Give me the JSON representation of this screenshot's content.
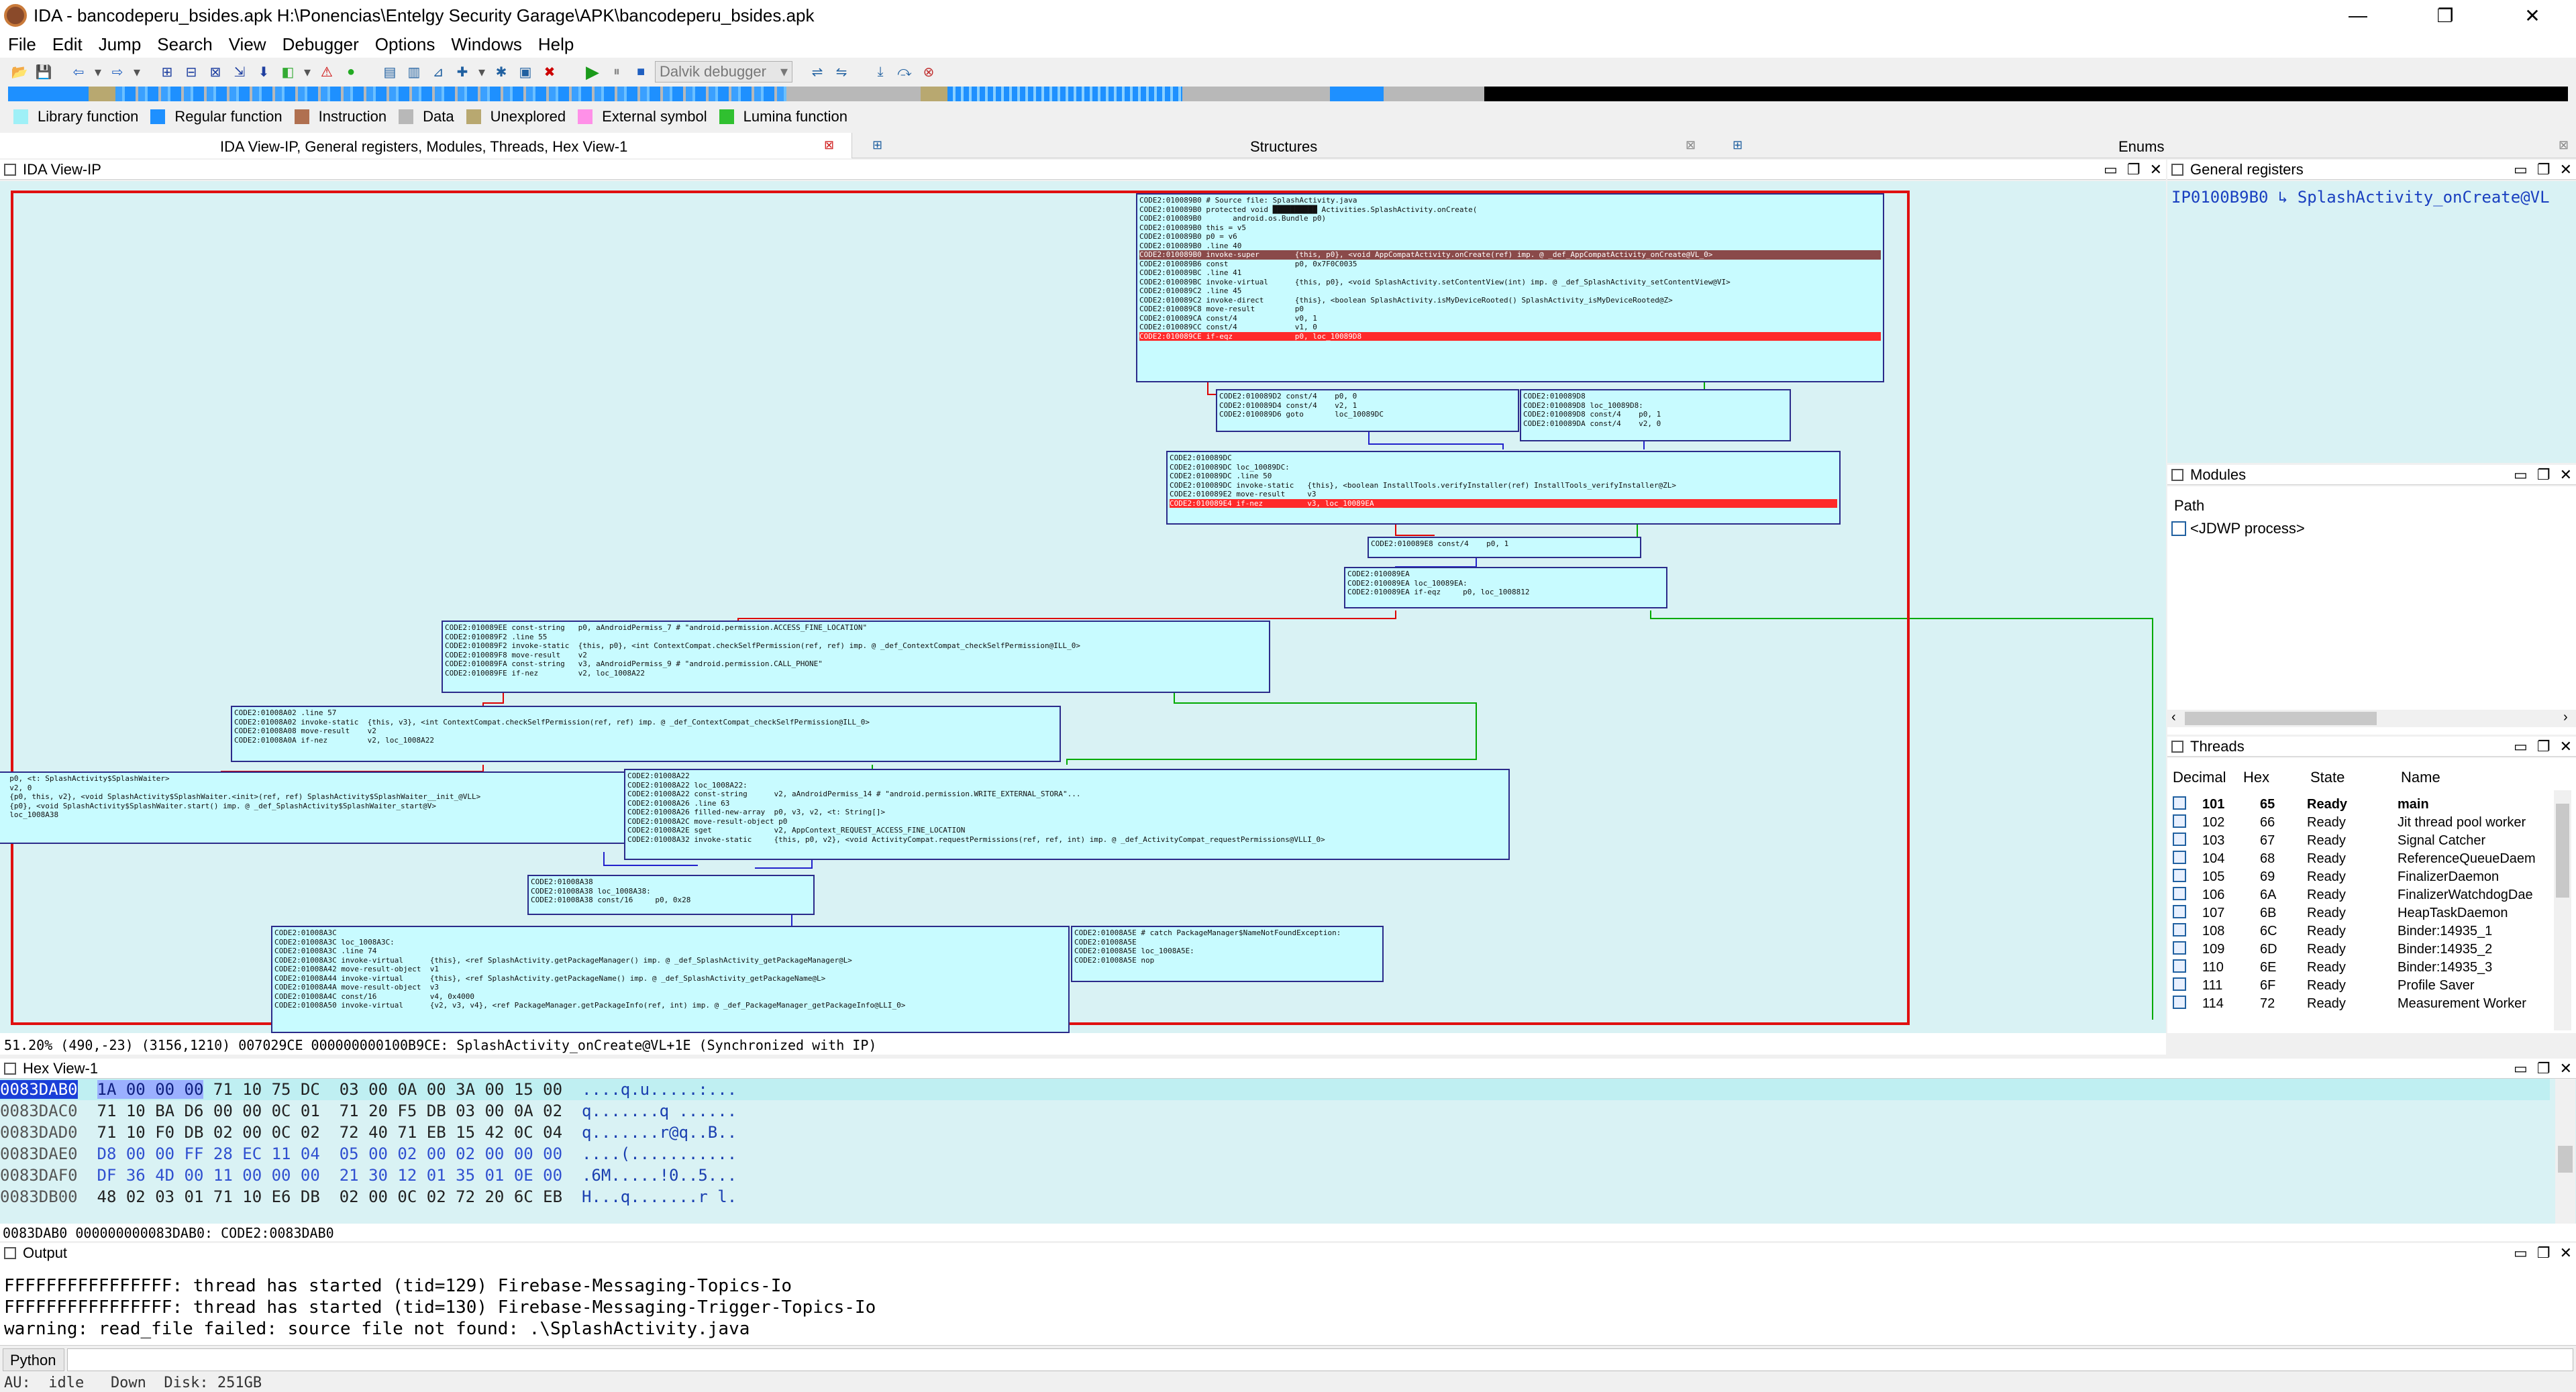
{
  "window": {
    "title": "IDA - bancodeperu_bsides.apk H:\\Ponencias\\Entelgy Security Garage\\APK\\bancodeperu_bsides.apk",
    "minimize": "—",
    "maximize": "❐",
    "close": "✕"
  },
  "menu": [
    "File",
    "Edit",
    "Jump",
    "Search",
    "View",
    "Debugger",
    "Options",
    "Windows",
    "Help"
  ],
  "toolbar": {
    "debugger_select": "Dalvik debugger"
  },
  "legend": [
    {
      "label": "Library function",
      "color": "#9ff0f7"
    },
    {
      "label": "Regular function",
      "color": "#1e90ff"
    },
    {
      "label": "Instruction",
      "color": "#b07050"
    },
    {
      "label": "Data",
      "color": "#b8b8b8"
    },
    {
      "label": "Unexplored",
      "color": "#b8a870"
    },
    {
      "label": "External symbol",
      "color": "#ff90e8"
    },
    {
      "label": "Lumina function",
      "color": "#30c030"
    }
  ],
  "tabs": {
    "ida_group": "IDA View-IP, General registers, Modules, Threads, Hex View-1",
    "structures": "Structures",
    "enums": "Enums"
  },
  "ida_view": {
    "title": "IDA View-IP",
    "status": "51.20% (490,-23) (3156,1210) 007029CE 000000000100B9CE: SplashActivity_onCreate@VL+1E (Synchronized with IP)"
  },
  "graph_blocks": [
    {
      "lines": [
        "CODE2:010089B0 # Source file: SplashActivity.java",
        "CODE2:010089B0 protected void ██████████ Activities.SplashActivity.onCreate(",
        "CODE2:010089B0       android.os.Bundle p0)",
        "CODE2:010089B0 this = v5",
        "CODE2:010089B0 p0 = v6",
        "CODE2:010089B0 .line 40",
        "CODE2:010089B0 invoke-super        {this, p0}, <void AppCompatActivity.onCreate(ref) imp. @ _def_AppCompatActivity_onCreate@VL_0>",
        "CODE2:010089B6 const               p0, 0x7F0C0035",
        "CODE2:010089BC .line 41",
        "CODE2:010089BC invoke-virtual      {this, p0}, <void SplashActivity.setContentView(int) imp. @ _def_SplashActivity_setContentView@VI>",
        "CODE2:010089C2 .line 45",
        "CODE2:010089C2 invoke-direct       {this}, <boolean SplashActivity.isMyDeviceRooted() SplashActivity_isMyDeviceRooted@Z>",
        "CODE2:010089C8 move-result         p0",
        "CODE2:010089CA const/4             v0, 1",
        "CODE2:010089CC const/4             v1, 0",
        "CODE2:010089CE if-eqz              p0, loc_10089D8"
      ]
    },
    {
      "lines": [
        "CODE2:010089D2 const/4    p0, 0",
        "CODE2:010089D4 const/4    v2, 1",
        "CODE2:010089D6 goto       loc_10089DC"
      ]
    },
    {
      "lines": [
        "CODE2:010089D8",
        "CODE2:010089D8 loc_10089D8:",
        "CODE2:010089D8 const/4    p0, 1",
        "CODE2:010089DA const/4    v2, 0"
      ]
    },
    {
      "lines": [
        "CODE2:010089DC",
        "CODE2:010089DC loc_10089DC:",
        "CODE2:010089DC .line 50",
        "CODE2:010089DC invoke-static   {this}, <boolean InstallTools.verifyInstaller(ref) InstallTools_verifyInstaller@ZL>",
        "CODE2:010089E2 move-result     v3",
        "CODE2:010089E4 if-nez          v3, loc_10089EA"
      ]
    },
    {
      "lines": [
        "CODE2:010089E8 const/4    p0, 1"
      ]
    },
    {
      "lines": [
        "CODE2:010089EA",
        "CODE2:010089EA loc_10089EA:",
        "CODE2:010089EA if-eqz     p0, loc_1008812"
      ]
    },
    {
      "lines": [
        "CODE2:010089EE const-string   p0, aAndroidPermiss_7 # \"android.permission.ACCESS_FINE_LOCATION\"",
        "CODE2:010089F2 .line 55",
        "CODE2:010089F2 invoke-static  {this, p0}, <int ContextCompat.checkSelfPermission(ref, ref) imp. @ _def_ContextCompat_checkSelfPermission@ILL_0>",
        "CODE2:010089F8 move-result    v2",
        "CODE2:010089FA const-string   v3, aAndroidPermiss_9 # \"android.permission.CALL_PHONE\"",
        "CODE2:010089FE if-nez         v2, loc_1008A22"
      ]
    },
    {
      "lines": [
        "CODE2:01008A02 .line 57",
        "CODE2:01008A02 invoke-static  {this, v3}, <int ContextCompat.checkSelfPermission(ref, ref) imp. @ _def_ContextCompat_checkSelfPermission@ILL_0>",
        "CODE2:01008A08 move-result    v2",
        "CODE2:01008A0A if-nez         v2, loc_1008A22"
      ]
    },
    {
      "lines": [
        "  p0, <t: SplashActivity$SplashWaiter>",
        "  v2, 0",
        "  {p0, this, v2}, <void SplashActivity$SplashWaiter.<init>(ref, ref) SplashActivity$SplashWaiter__init_@VLL>",
        "",
        "  {p0}, <void SplashActivity$SplashWaiter.start() imp. @ _def_SplashActivity$SplashWaiter_start@V>",
        "  loc_1008A38"
      ]
    },
    {
      "lines": [
        "CODE2:01008A22",
        "CODE2:01008A22 loc_1008A22:",
        "CODE2:01008A22 const-string      v2, aAndroidPermiss_14 # \"android.permission.WRITE_EXTERNAL_STORA\"...",
        "CODE2:01008A26 .line 63",
        "CODE2:01008A26 filled-new-array  p0, v3, v2, <t: String[]>",
        "CODE2:01008A2C move-result-object p0",
        "CODE2:01008A2E sget              v2, AppContext_REQUEST_ACCESS_FINE_LOCATION",
        "CODE2:01008A32 invoke-static     {this, p0, v2}, <void ActivityCompat.requestPermissions(ref, ref, int) imp. @ _def_ActivityCompat_requestPermissions@VLLI_0>"
      ]
    },
    {
      "lines": [
        "CODE2:01008A38",
        "CODE2:01008A38 loc_1008A38:",
        "CODE2:01008A38 const/16     p0, 0x28"
      ]
    },
    {
      "lines": [
        "CODE2:01008A3C",
        "CODE2:01008A3C loc_1008A3C:",
        "CODE2:01008A3C .line 74",
        "CODE2:01008A3C invoke-virtual      {this}, <ref SplashActivity.getPackageManager() imp. @ _def_SplashActivity_getPackageManager@L>",
        "CODE2:01008A42 move-result-object  v1",
        "CODE2:01008A44 invoke-virtual      {this}, <ref SplashActivity.getPackageName() imp. @ _def_SplashActivity_getPackageName@L>",
        "CODE2:01008A4A move-result-object  v3",
        "CODE2:01008A4C const/16            v4, 0x4000",
        "CODE2:01008A50 invoke-virtual      {v2, v3, v4}, <ref PackageManager.getPackageInfo(ref, int) imp. @ _def_PackageManager_getPackageInfo@LLI_0>"
      ]
    },
    {
      "lines": [
        "CODE2:01008A5E # catch PackageManager$NameNotFoundException:",
        "CODE2:01008A5E",
        "CODE2:01008A5E loc_1008A5E:",
        "CODE2:01008A5E nop"
      ]
    }
  ],
  "registers": {
    "title": "General registers",
    "ip_label": "IP",
    "ip_value": "0100B9B0",
    "ip_target": "SplashActivity_onCreate@VL"
  },
  "modules": {
    "title": "Modules",
    "col_path": "Path",
    "items": [
      "<JDWP process>"
    ]
  },
  "threads": {
    "title": "Threads",
    "columns": [
      "Decimal",
      "Hex",
      "State",
      "Name"
    ],
    "rows": [
      [
        "101",
        "65",
        "Ready",
        "main"
      ],
      [
        "102",
        "66",
        "Ready",
        "Jit thread pool worker"
      ],
      [
        "103",
        "67",
        "Ready",
        "Signal Catcher"
      ],
      [
        "104",
        "68",
        "Ready",
        "ReferenceQueueDaem"
      ],
      [
        "105",
        "69",
        "Ready",
        "FinalizerDaemon"
      ],
      [
        "106",
        "6A",
        "Ready",
        "FinalizerWatchdogDae"
      ],
      [
        "107",
        "6B",
        "Ready",
        "HeapTaskDaemon"
      ],
      [
        "108",
        "6C",
        "Ready",
        "Binder:14935_1"
      ],
      [
        "109",
        "6D",
        "Ready",
        "Binder:14935_2"
      ],
      [
        "110",
        "6E",
        "Ready",
        "Binder:14935_3"
      ],
      [
        "111",
        "6F",
        "Ready",
        "Profile Saver"
      ],
      [
        "114",
        "72",
        "Ready",
        "Measurement Worker"
      ]
    ]
  },
  "hex": {
    "title": "Hex View-1",
    "rows": [
      {
        "addr": "0083DAB0",
        "sel": "1A 00 00 00",
        "bytes": " 71 10 75 DC  03 00 0A 00 3A 00 15 00",
        "ascii": "....q.u.....:..."
      },
      {
        "addr": "0083DAC0",
        "sel": "",
        "bytes": "71 10 BA D6 00 00 0C 01  71 20 F5 DB 03 00 0A 02",
        "ascii": "q.......q ......"
      },
      {
        "addr": "0083DAD0",
        "sel": "",
        "bytes": "71 10 F0 DB 02 00 0C 02  72 40 71 EB 15 42 0C 04",
        "ascii": "q.......r@q..B.."
      },
      {
        "addr": "0083DAE0",
        "sel": "",
        "bytes": "D8 00 00 FF 28 EC 11 04  05 00 02 00 02 00 00 00",
        "ascii": "....(..........."
      },
      {
        "addr": "0083DAF0",
        "sel": "",
        "bytes": "DF 36 4D 00 11 00 00 00  21 30 12 01 35 01 0E 00",
        "ascii": ".6M.....!0..5..."
      },
      {
        "addr": "0083DB00",
        "sel": "",
        "bytes": "48 02 03 01 71 10 E6 DB  02 00 0C 02 72 20 6C EB",
        "ascii": "H...q.......r l."
      }
    ],
    "status": "0083DAB0 000000000083DAB0: CODE2:0083DAB0"
  },
  "output": {
    "title": "Output",
    "lines": [
      "FFFFFFFFFFFFFFFF: thread has started (tid=129) Firebase-Messaging-Topics-Io",
      "FFFFFFFFFFFFFFFF: thread has started (tid=130) Firebase-Messaging-Trigger-Topics-Io",
      "warning: read_file failed: source file not found: .\\SplashActivity.java"
    ],
    "python_label": "Python"
  },
  "status": {
    "text": "AU:  idle   Down  Disk: 251GB"
  }
}
